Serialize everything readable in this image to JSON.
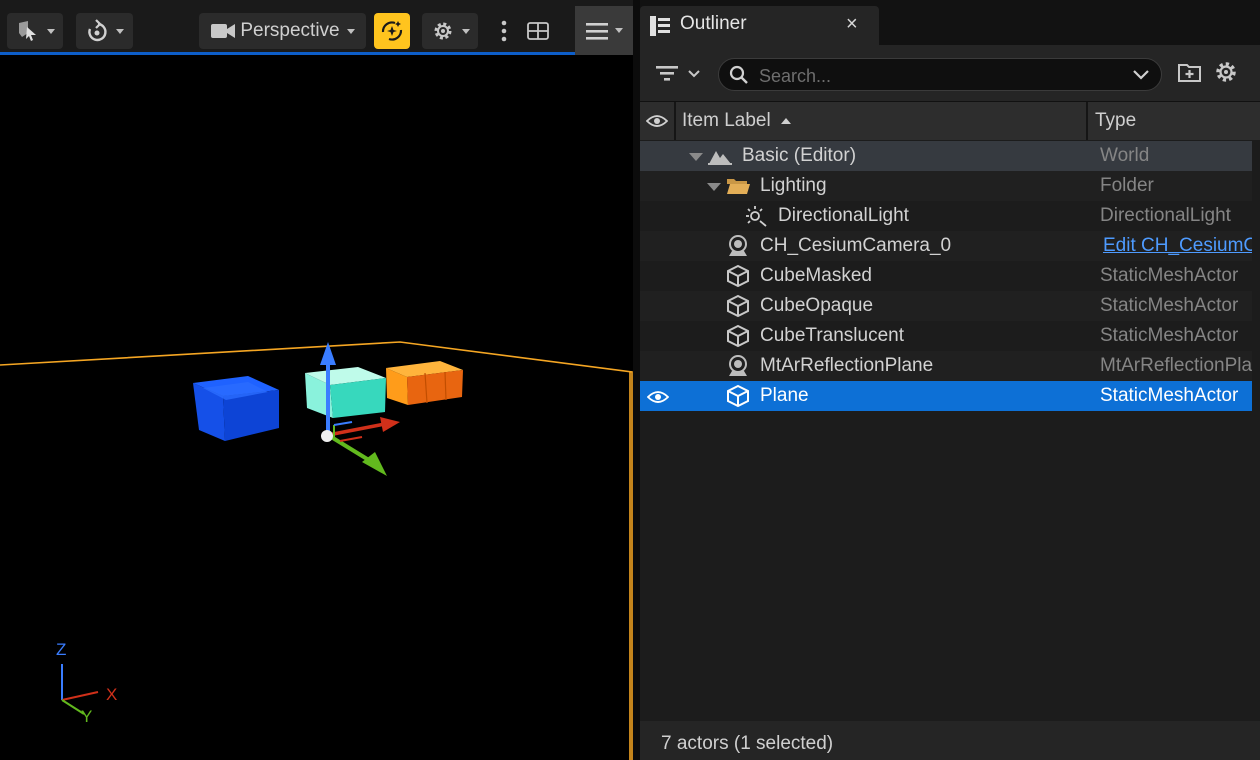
{
  "viewport": {
    "toolbar": {
      "select_icon": "select-mode-icon",
      "transform_icon": "transform-mode-icon",
      "perspective_label": "Perspective",
      "realtime_icon": "realtime-sparkle-icon",
      "show_icon": "gear-icon",
      "more_icon": "vertical-dots-icon",
      "layout_icon": "grid-layout-icon",
      "menu_icon": "hamburger-menu-icon"
    },
    "axis_labels": {
      "z": "Z",
      "x": "X",
      "y": "Y"
    },
    "colors": {
      "accent": "#0d5ec9",
      "selection_outline": "#f5a623",
      "cube_blue": "#1a5cff",
      "cube_cyan": "#4fe0c8",
      "cube_orange": "#ff8c1a"
    }
  },
  "outliner": {
    "tab": {
      "title": "Outliner",
      "close": "×",
      "icon": "outliner-icon"
    },
    "search": {
      "placeholder": "Search...",
      "value": ""
    },
    "columns": {
      "label": "Item Label",
      "type": "Type",
      "visibility_icon": "eye-icon"
    },
    "rows": [
      {
        "label": "Basic (Editor)",
        "type": "World",
        "icon": "world-icon"
      },
      {
        "label": "Lighting",
        "type": "Folder",
        "icon": "folder-icon"
      },
      {
        "label": "DirectionalLight",
        "type": "DirectionalLight",
        "icon": "directional-light-icon"
      },
      {
        "label": "CH_CesiumCamera_0",
        "type": "Edit CH_CesiumC",
        "icon": "actor-icon"
      },
      {
        "label": "CubeMasked",
        "type": "StaticMeshActor",
        "icon": "static-mesh-icon"
      },
      {
        "label": "CubeOpaque",
        "type": "StaticMeshActor",
        "icon": "static-mesh-icon"
      },
      {
        "label": "CubeTranslucent",
        "type": "StaticMeshActor",
        "icon": "static-mesh-icon"
      },
      {
        "label": "MtArReflectionPlane",
        "type": "MtArReflectionPla",
        "icon": "actor-icon"
      },
      {
        "label": "Plane",
        "type": "StaticMeshActor",
        "icon": "static-mesh-icon"
      }
    ],
    "status": "7 actors (1 selected)",
    "colors": {
      "selected_row": "#0d70d6",
      "link": "#4e9bff"
    }
  }
}
